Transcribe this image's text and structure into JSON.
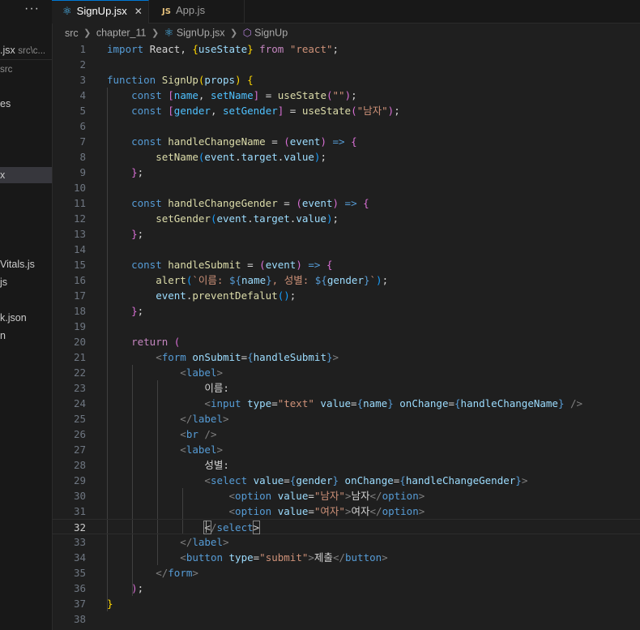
{
  "sidebar": {
    "more_label": "···",
    "items": [
      {
        "label": ".jsx",
        "sub": "src\\c...",
        "selected": false
      },
      {
        "label": "src",
        "sub": "",
        "selected": false
      },
      {
        "label": "es",
        "sub": "",
        "selected": false
      },
      {
        "label": "x",
        "sub": "",
        "selected": true
      },
      {
        "label": "Vitals.js",
        "sub": "",
        "selected": false
      },
      {
        "label": "js",
        "sub": "",
        "selected": false
      },
      {
        "label": "k.json",
        "sub": "",
        "selected": false
      },
      {
        "label": "n",
        "sub": "",
        "selected": false
      }
    ]
  },
  "tabs": [
    {
      "label": "SignUp.jsx",
      "icon": "react-icon",
      "active": true,
      "close": "✕"
    },
    {
      "label": "App.js",
      "icon": "js-icon",
      "active": false,
      "icon_text": "JS"
    }
  ],
  "breadcrumb": [
    "src",
    "chapter_11",
    "SignUp.jsx",
    "SignUp"
  ],
  "editor": {
    "current_line": 32,
    "lines": [
      [
        [
          "kw",
          "import "
        ],
        [
          "txt",
          "React, "
        ],
        [
          "br1",
          "{"
        ],
        [
          "var",
          "useState"
        ],
        [
          "br1",
          "}"
        ],
        [
          "ctl",
          " from "
        ],
        [
          "str",
          "\"react\""
        ],
        [
          "txt",
          ";"
        ]
      ],
      [],
      [
        [
          "kw",
          "function "
        ],
        [
          "fn",
          "SignUp"
        ],
        [
          "br1",
          "("
        ],
        [
          "var",
          "props"
        ],
        [
          "br1",
          ")"
        ],
        [
          "txt",
          " "
        ],
        [
          "br1",
          "{"
        ]
      ],
      [
        [
          "kw",
          "    const "
        ],
        [
          "br2",
          "["
        ],
        [
          "cst",
          "name"
        ],
        [
          "txt",
          ", "
        ],
        [
          "cst",
          "setName"
        ],
        [
          "br2",
          "]"
        ],
        [
          "txt",
          " = "
        ],
        [
          "fn",
          "useState"
        ],
        [
          "br2",
          "("
        ],
        [
          "str",
          "\"\""
        ],
        [
          "br2",
          ")"
        ],
        [
          "txt",
          ";"
        ]
      ],
      [
        [
          "kw",
          "    const "
        ],
        [
          "br2",
          "["
        ],
        [
          "cst",
          "gender"
        ],
        [
          "txt",
          ", "
        ],
        [
          "cst",
          "setGender"
        ],
        [
          "br2",
          "]"
        ],
        [
          "txt",
          " = "
        ],
        [
          "fn",
          "useState"
        ],
        [
          "br2",
          "("
        ],
        [
          "str",
          "\"남자\""
        ],
        [
          "br2",
          ")"
        ],
        [
          "txt",
          ";"
        ]
      ],
      [],
      [
        [
          "kw",
          "    const "
        ],
        [
          "fn",
          "handleChangeName"
        ],
        [
          "txt",
          " = "
        ],
        [
          "br2",
          "("
        ],
        [
          "var",
          "event"
        ],
        [
          "br2",
          ")"
        ],
        [
          "kw",
          " => "
        ],
        [
          "br2",
          "{"
        ]
      ],
      [
        [
          "fn",
          "        setName"
        ],
        [
          "br3",
          "("
        ],
        [
          "var",
          "event"
        ],
        [
          "txt",
          "."
        ],
        [
          "var",
          "target"
        ],
        [
          "txt",
          "."
        ],
        [
          "var",
          "value"
        ],
        [
          "br3",
          ")"
        ],
        [
          "txt",
          ";"
        ]
      ],
      [
        [
          "br2",
          "    }"
        ],
        [
          "txt",
          ";"
        ]
      ],
      [],
      [
        [
          "kw",
          "    const "
        ],
        [
          "fn",
          "handleChangeGender"
        ],
        [
          "txt",
          " = "
        ],
        [
          "br2",
          "("
        ],
        [
          "var",
          "event"
        ],
        [
          "br2",
          ")"
        ],
        [
          "kw",
          " => "
        ],
        [
          "br2",
          "{"
        ]
      ],
      [
        [
          "fn",
          "        setGender"
        ],
        [
          "br3",
          "("
        ],
        [
          "var",
          "event"
        ],
        [
          "txt",
          "."
        ],
        [
          "var",
          "target"
        ],
        [
          "txt",
          "."
        ],
        [
          "var",
          "value"
        ],
        [
          "br3",
          ")"
        ],
        [
          "txt",
          ";"
        ]
      ],
      [
        [
          "br2",
          "    }"
        ],
        [
          "txt",
          ";"
        ]
      ],
      [],
      [
        [
          "kw",
          "    const "
        ],
        [
          "fn",
          "handleSubmit"
        ],
        [
          "txt",
          " = "
        ],
        [
          "br2",
          "("
        ],
        [
          "var",
          "event"
        ],
        [
          "br2",
          ")"
        ],
        [
          "kw",
          " => "
        ],
        [
          "br2",
          "{"
        ]
      ],
      [
        [
          "fn",
          "        alert"
        ],
        [
          "br3",
          "("
        ],
        [
          "str",
          "`이름: "
        ],
        [
          "kw",
          "${"
        ],
        [
          "var",
          "name"
        ],
        [
          "kw",
          "}"
        ],
        [
          "str",
          ", 성별: "
        ],
        [
          "kw",
          "${"
        ],
        [
          "var",
          "gender"
        ],
        [
          "kw",
          "}"
        ],
        [
          "str",
          "`"
        ],
        [
          "br3",
          ")"
        ],
        [
          "txt",
          ";"
        ]
      ],
      [
        [
          "var",
          "        event"
        ],
        [
          "txt",
          "."
        ],
        [
          "fn",
          "preventDefalut"
        ],
        [
          "br3",
          "()"
        ],
        [
          "txt",
          ";"
        ]
      ],
      [
        [
          "br2",
          "    }"
        ],
        [
          "txt",
          ";"
        ]
      ],
      [],
      [
        [
          "ctl",
          "    return "
        ],
        [
          "br2",
          "("
        ]
      ],
      [
        [
          "pun",
          "        <"
        ],
        [
          "tag",
          "form "
        ],
        [
          "var",
          "onSubmit"
        ],
        [
          "txt",
          "="
        ],
        [
          "kw",
          "{"
        ],
        [
          "var",
          "handleSubmit"
        ],
        [
          "kw",
          "}"
        ],
        [
          "pun",
          ">"
        ]
      ],
      [
        [
          "pun",
          "            <"
        ],
        [
          "tag",
          "label"
        ],
        [
          "pun",
          ">"
        ]
      ],
      [
        [
          "txt",
          "                이름:"
        ]
      ],
      [
        [
          "pun",
          "                <"
        ],
        [
          "tag",
          "input "
        ],
        [
          "var",
          "type"
        ],
        [
          "txt",
          "="
        ],
        [
          "str",
          "\"text\""
        ],
        [
          "var",
          " value"
        ],
        [
          "txt",
          "="
        ],
        [
          "kw",
          "{"
        ],
        [
          "var",
          "name"
        ],
        [
          "kw",
          "}"
        ],
        [
          "var",
          " onChange"
        ],
        [
          "txt",
          "="
        ],
        [
          "kw",
          "{"
        ],
        [
          "var",
          "handleChangeName"
        ],
        [
          "kw",
          "}"
        ],
        [
          "pun",
          " />"
        ]
      ],
      [
        [
          "pun",
          "            </"
        ],
        [
          "tag",
          "label"
        ],
        [
          "pun",
          ">"
        ]
      ],
      [
        [
          "pun",
          "            <"
        ],
        [
          "tag",
          "br"
        ],
        [
          "pun",
          " />"
        ]
      ],
      [
        [
          "pun",
          "            <"
        ],
        [
          "tag",
          "label"
        ],
        [
          "pun",
          ">"
        ]
      ],
      [
        [
          "txt",
          "                성별:"
        ]
      ],
      [
        [
          "pun",
          "                <"
        ],
        [
          "tag",
          "select "
        ],
        [
          "var",
          "value"
        ],
        [
          "txt",
          "="
        ],
        [
          "kw",
          "{"
        ],
        [
          "var",
          "gender"
        ],
        [
          "kw",
          "}"
        ],
        [
          "var",
          " onChange"
        ],
        [
          "txt",
          "="
        ],
        [
          "kw",
          "{"
        ],
        [
          "var",
          "handleChangeGender"
        ],
        [
          "kw",
          "}"
        ],
        [
          "pun",
          ">"
        ]
      ],
      [
        [
          "pun",
          "                    <"
        ],
        [
          "tag",
          "option "
        ],
        [
          "var",
          "value"
        ],
        [
          "txt",
          "="
        ],
        [
          "str",
          "\"남자\""
        ],
        [
          "pun",
          ">"
        ],
        [
          "txt",
          "남자"
        ],
        [
          "pun",
          "</"
        ],
        [
          "tag",
          "option"
        ],
        [
          "pun",
          ">"
        ]
      ],
      [
        [
          "pun",
          "                    <"
        ],
        [
          "tag",
          "option "
        ],
        [
          "var",
          "value"
        ],
        [
          "txt",
          "="
        ],
        [
          "str",
          "\"여자\""
        ],
        [
          "pun",
          ">"
        ],
        [
          "txt",
          "여자"
        ],
        [
          "pun",
          "</"
        ],
        [
          "tag",
          "option"
        ],
        [
          "pun",
          ">"
        ]
      ],
      [
        [
          "txt",
          "                "
        ],
        [
          "hl",
          "<"
        ],
        [
          "pun",
          "/"
        ],
        [
          "tag",
          "select"
        ],
        [
          "hl",
          ">"
        ]
      ],
      [
        [
          "pun",
          "            </"
        ],
        [
          "tag",
          "label"
        ],
        [
          "pun",
          ">"
        ]
      ],
      [
        [
          "pun",
          "            <"
        ],
        [
          "tag",
          "button "
        ],
        [
          "var",
          "type"
        ],
        [
          "txt",
          "="
        ],
        [
          "str",
          "\"submit\""
        ],
        [
          "pun",
          ">"
        ],
        [
          "txt",
          "제출"
        ],
        [
          "pun",
          "</"
        ],
        [
          "tag",
          "button"
        ],
        [
          "pun",
          ">"
        ]
      ],
      [
        [
          "pun",
          "        </"
        ],
        [
          "tag",
          "form"
        ],
        [
          "pun",
          ">"
        ]
      ],
      [
        [
          "br2",
          "    )"
        ],
        [
          "txt",
          ";"
        ]
      ],
      [
        [
          "br1",
          "}"
        ]
      ],
      []
    ]
  }
}
